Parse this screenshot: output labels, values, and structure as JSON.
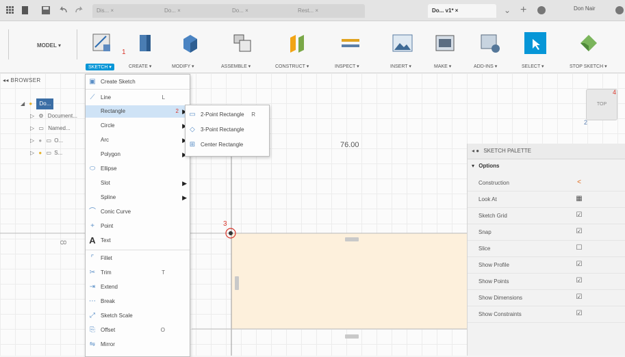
{
  "top_tabs": [
    "Dis...",
    "Do...",
    "Do...",
    "Rest...",
    "Do... v1*"
  ],
  "active_tab_label": "Do... v1*",
  "user": "Don Nair",
  "ribbon": {
    "model_label": "MODEL ▾",
    "groups": [
      "SKETCH ▾",
      "CREATE ▾",
      "MODIFY ▾",
      "ASSEMBLE ▾",
      "CONSTRUCT ▾",
      "INSPECT ▾",
      "INSERT ▾",
      "MAKE ▾",
      "ADD-INS ▾",
      "SELECT ▾",
      "STOP SKETCH ▾"
    ]
  },
  "annotations": {
    "step1": "1",
    "step2": "2",
    "step3": "3",
    "step4": "4"
  },
  "browser": {
    "header": "BROWSER",
    "rows": [
      "Do...",
      "Document...",
      "Named...",
      "O...",
      "S..."
    ]
  },
  "sketch_menu": {
    "items": [
      {
        "label": "Create Sketch",
        "shortcut": "",
        "icon": "sketch-icon",
        "arrow": false
      },
      {
        "label": "Line",
        "shortcut": "L",
        "icon": "line-icon",
        "arrow": false
      },
      {
        "label": "Rectangle",
        "shortcut": "",
        "icon": "",
        "arrow": true
      },
      {
        "label": "Circle",
        "shortcut": "",
        "icon": "",
        "arrow": true
      },
      {
        "label": "Arc",
        "shortcut": "",
        "icon": "",
        "arrow": true
      },
      {
        "label": "Polygon",
        "shortcut": "",
        "icon": "",
        "arrow": true
      },
      {
        "label": "Ellipse",
        "shortcut": "",
        "icon": "ellipse-icon",
        "arrow": false
      },
      {
        "label": "Slot",
        "shortcut": "",
        "icon": "",
        "arrow": true
      },
      {
        "label": "Spline",
        "shortcut": "",
        "icon": "",
        "arrow": true
      },
      {
        "label": "Conic Curve",
        "shortcut": "",
        "icon": "conic-icon",
        "arrow": false
      },
      {
        "label": "Point",
        "shortcut": "",
        "icon": "point-icon",
        "arrow": false
      },
      {
        "label": "Text",
        "shortcut": "",
        "icon": "text-icon",
        "arrow": false
      },
      {
        "label": "Fillet",
        "shortcut": "",
        "icon": "fillet-icon",
        "arrow": false
      },
      {
        "label": "Trim",
        "shortcut": "T",
        "icon": "trim-icon",
        "arrow": false
      },
      {
        "label": "Extend",
        "shortcut": "",
        "icon": "extend-icon",
        "arrow": false
      },
      {
        "label": "Break",
        "shortcut": "",
        "icon": "break-icon",
        "arrow": false
      },
      {
        "label": "Sketch Scale",
        "shortcut": "",
        "icon": "scale-icon",
        "arrow": false
      },
      {
        "label": "Offset",
        "shortcut": "O",
        "icon": "offset-icon",
        "arrow": false
      },
      {
        "label": "Mirror",
        "shortcut": "",
        "icon": "mirror-icon",
        "arrow": false
      }
    ]
  },
  "rect_submenu": {
    "items": [
      {
        "label": "2-Point Rectangle",
        "shortcut": "R"
      },
      {
        "label": "3-Point Rectangle",
        "shortcut": ""
      },
      {
        "label": "Center Rectangle",
        "shortcut": ""
      }
    ]
  },
  "canvas": {
    "dimension": "76.00",
    "left_dim": "8",
    "viewcube_label": "TOP"
  },
  "palette": {
    "title": "SKETCH PALETTE",
    "section": "Options",
    "rows": [
      {
        "label": "Construction",
        "icon": "construction-icon"
      },
      {
        "label": "Look At",
        "icon": "look-at-icon"
      },
      {
        "label": "Sketch Grid",
        "icon": "checkbox-checked"
      },
      {
        "label": "Snap",
        "icon": "checkbox-checked"
      },
      {
        "label": "Slice",
        "icon": "checkbox-empty"
      },
      {
        "label": "Show Profile",
        "icon": "checkbox-checked"
      },
      {
        "label": "Show Points",
        "icon": "checkbox-checked"
      },
      {
        "label": "Show Dimensions",
        "icon": "checkbox-checked"
      },
      {
        "label": "Show Constraints",
        "icon": "checkbox-checked"
      }
    ]
  },
  "colors": {
    "accent": "#0696d7",
    "annotation": "#d9362b",
    "profile_fill": "#fdf0dc"
  }
}
